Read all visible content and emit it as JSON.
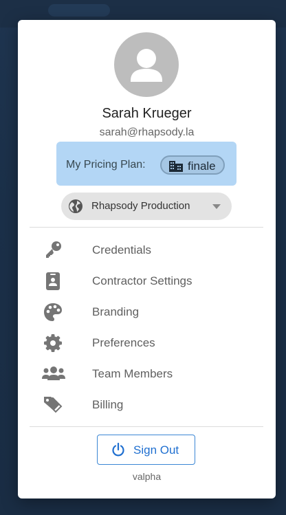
{
  "user": {
    "name": "Sarah Krueger",
    "email": "sarah@rhapsody.la"
  },
  "pricing_plan": {
    "label": "My Pricing Plan:",
    "plan_name": "finale",
    "plan_icon": "building-icon"
  },
  "organization": {
    "selected": "Rhapsody Production",
    "icon": "globe-icon"
  },
  "menu": {
    "items": [
      {
        "label": "Credentials",
        "icon": "key-icon"
      },
      {
        "label": "Contractor Settings",
        "icon": "badge-icon"
      },
      {
        "label": "Branding",
        "icon": "palette-icon"
      },
      {
        "label": "Preferences",
        "icon": "gear-icon"
      },
      {
        "label": "Team Members",
        "icon": "group-icon"
      },
      {
        "label": "Billing",
        "icon": "tags-icon"
      }
    ]
  },
  "sign_out": {
    "label": "Sign Out",
    "icon": "power-icon"
  },
  "version": "valpha",
  "colors": {
    "backdrop": "#1c2f46",
    "plan_background": "#b3d6f5",
    "accent": "#1f6fd0",
    "icon_gray": "#757575"
  }
}
